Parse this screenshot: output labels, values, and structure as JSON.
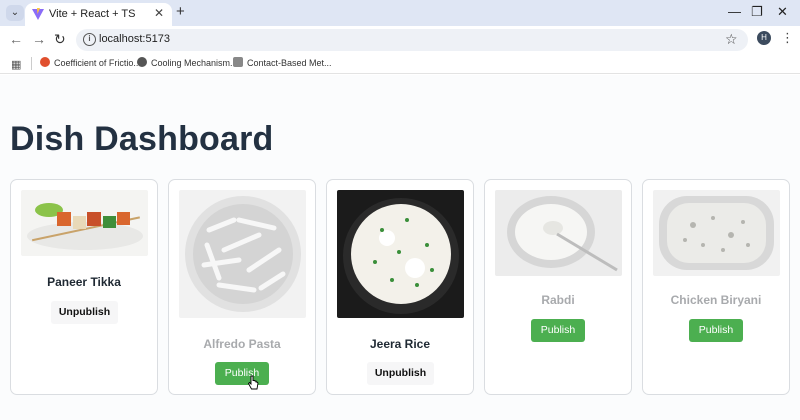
{
  "browser": {
    "tab_title": "Vite + React + TS",
    "url": "localhost:5173",
    "profile_initial": "H",
    "bookmarks": [
      "Coefficient of Frictio...",
      "Cooling Mechanism...",
      "Contact-Based Met..."
    ]
  },
  "page": {
    "title": "Dish Dashboard"
  },
  "dishes": [
    {
      "name": "Paneer Tikka",
      "published": true,
      "action": "Unpublish"
    },
    {
      "name": "Alfredo Pasta",
      "published": false,
      "action": "Publish"
    },
    {
      "name": "Jeera Rice",
      "published": true,
      "action": "Unpublish"
    },
    {
      "name": "Rabdi",
      "published": false,
      "action": "Publish"
    },
    {
      "name": "Chicken Biryani",
      "published": false,
      "action": "Publish"
    }
  ],
  "colors": {
    "publish_button": "#4caf50",
    "title": "#233142",
    "unpublished_name": "#a8aaad"
  }
}
